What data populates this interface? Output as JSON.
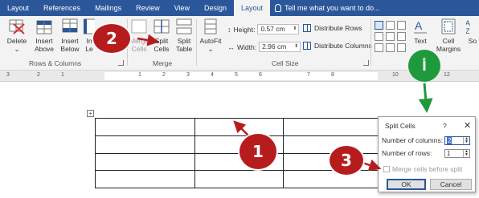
{
  "tabs": [
    {
      "label": "Layout"
    },
    {
      "label": "References"
    },
    {
      "label": "Mailings"
    },
    {
      "label": "Review"
    },
    {
      "label": "View"
    },
    {
      "label": "Design"
    },
    {
      "label": "Layout"
    },
    {
      "label": "Tell me what you want to do..."
    }
  ],
  "ribbon": {
    "delete_label": "Delete",
    "insert_above": "Insert Above",
    "insert_below": "Insert Below",
    "insert_left_partial": "In Le",
    "merge_cells": "Merge Cells",
    "split_cells": "Split Cells",
    "split_table": "Split Table",
    "autofit": "AutoFit",
    "height_label": "Height:",
    "height_value": "0.57 cm",
    "width_label": "Width:",
    "width_value": "2.96 cm",
    "distribute_rows": "Distribute Rows",
    "distribute_columns": "Distribute Columns",
    "text_direction_partial": "Text",
    "cell_margins": "Cell Margins",
    "sort_partial": "So",
    "group_rows_columns": "Rows & Columns",
    "group_merge": "Merge",
    "group_cell_size": "Cell Size"
  },
  "ruler": {
    "labels": [
      "3",
      "2",
      "1",
      "1",
      "2",
      "3",
      "4",
      "5",
      "6",
      "7",
      "8",
      "10",
      "12"
    ]
  },
  "dialog": {
    "title": "Split Cells",
    "help": "?",
    "close": "✕",
    "columns_label": "Number of columns:",
    "columns_value": "2",
    "rows_label": "Number of rows:",
    "rows_value": "1",
    "merge_label": "Merge cells before split",
    "ok": "OK",
    "cancel": "Cancel"
  },
  "callouts": {
    "one": "1",
    "two": "2",
    "three": "3",
    "green": "أ"
  },
  "colors": {
    "accent": "#2b579a",
    "callout_red": "#b71c1c",
    "callout_green": "#1e9a3c"
  }
}
